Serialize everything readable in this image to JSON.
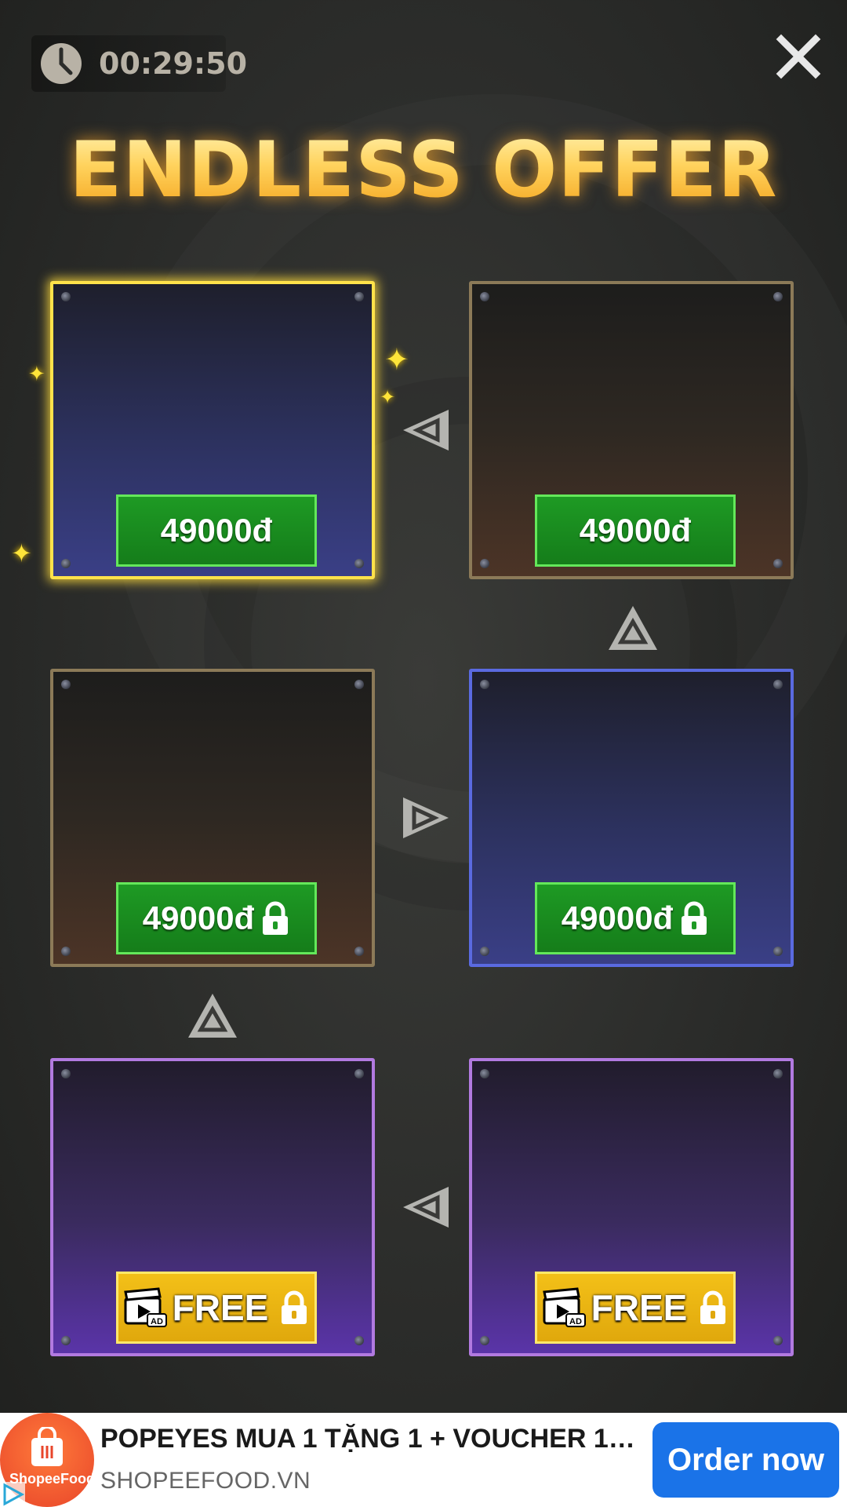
{
  "timer": {
    "icon": "clock-icon",
    "value": "00:29:50"
  },
  "close": {
    "icon": "close-icon"
  },
  "title": "ENDLESS OFFER",
  "offers": [
    {
      "label": "49000đ",
      "locked": false,
      "type": "paid",
      "frame": "gold",
      "theme": "blue"
    },
    {
      "label": "49000đ",
      "locked": false,
      "type": "paid",
      "frame": "bronze",
      "theme": "brown"
    },
    {
      "label": "49000đ",
      "locked": true,
      "type": "paid",
      "frame": "bronze",
      "theme": "brown"
    },
    {
      "label": "49000đ",
      "locked": true,
      "type": "paid",
      "frame": "blue",
      "theme": "blue"
    },
    {
      "label": "FREE",
      "locked": true,
      "type": "ad",
      "frame": "violet",
      "theme": "purple"
    },
    {
      "label": "FREE",
      "locked": true,
      "type": "ad",
      "frame": "violet",
      "theme": "purple"
    }
  ],
  "ad_banner": {
    "logo_text": "ShopeeFood",
    "title": "POPEYES MUA 1 TẶNG 1 + VOUCHER 1…",
    "source": "SHOPEEFOOD.VN",
    "cta": "Order now"
  },
  "colors": {
    "title_gold": "#ffd25c",
    "price_green": "#1e9a24",
    "free_yellow": "#f3c018",
    "cta_blue": "#1a73e8"
  }
}
